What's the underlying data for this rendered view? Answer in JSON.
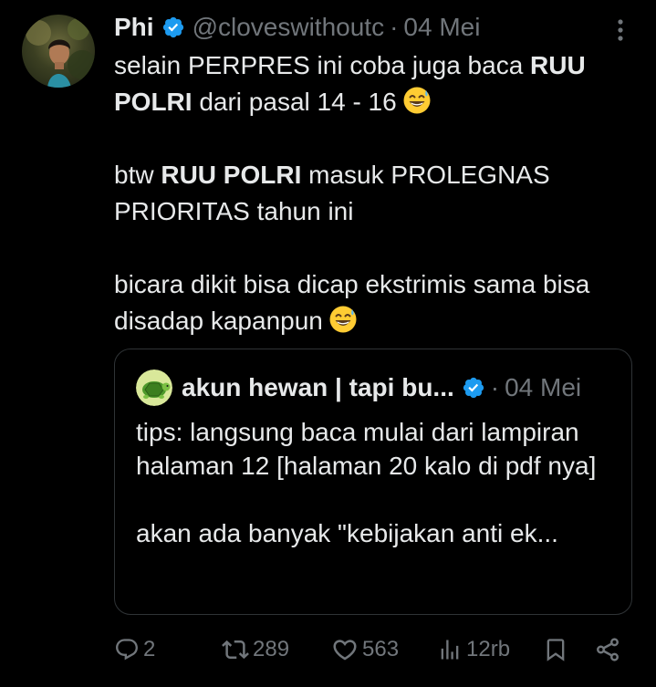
{
  "tweet": {
    "author": {
      "display_name": "Phi",
      "handle": "@cloveswithoutc",
      "verified": true,
      "avatar_icon": "profile-photo"
    },
    "separator": "·",
    "date": "04 Mei",
    "text": {
      "line1_pre": "selain PERPRES ini coba juga baca ",
      "line1_bold": "RUU POLRI",
      "line1_post": " dari pasal 14 - 16",
      "line2_pre": "btw ",
      "line2_bold": "RUU POLRI",
      "line2_post": " masuk PROLEGNAS PRIORITAS tahun ini",
      "line3": "bicara dikit bisa dicap ekstrimis sama bisa disadap kapanpun",
      "emoji": "grinning-face-with-sweat"
    }
  },
  "quote": {
    "author": {
      "display_name": "akun hewan | tapi bu...",
      "verified": true,
      "avatar_icon": "turtle"
    },
    "separator": "·",
    "date": "04 Mei",
    "text": {
      "para1": "tips: langsung baca mulai dari lampiran halaman 12 [halaman 20 kalo di pdf nya]",
      "para2": "akan ada banyak \"kebijakan anti ek..."
    }
  },
  "actions": {
    "reply": {
      "icon": "reply-icon",
      "count": "2"
    },
    "retweet": {
      "icon": "retweet-icon",
      "count": "289"
    },
    "like": {
      "icon": "like-icon",
      "count": "563"
    },
    "views": {
      "icon": "views-icon",
      "count": "12rb"
    },
    "bookmark": {
      "icon": "bookmark-icon"
    },
    "share": {
      "icon": "share-icon"
    }
  },
  "colors": {
    "background": "#000000",
    "text": "#e7e9ea",
    "muted": "#71767b",
    "verified": "#1d9bf0",
    "border": "#2f3336"
  }
}
